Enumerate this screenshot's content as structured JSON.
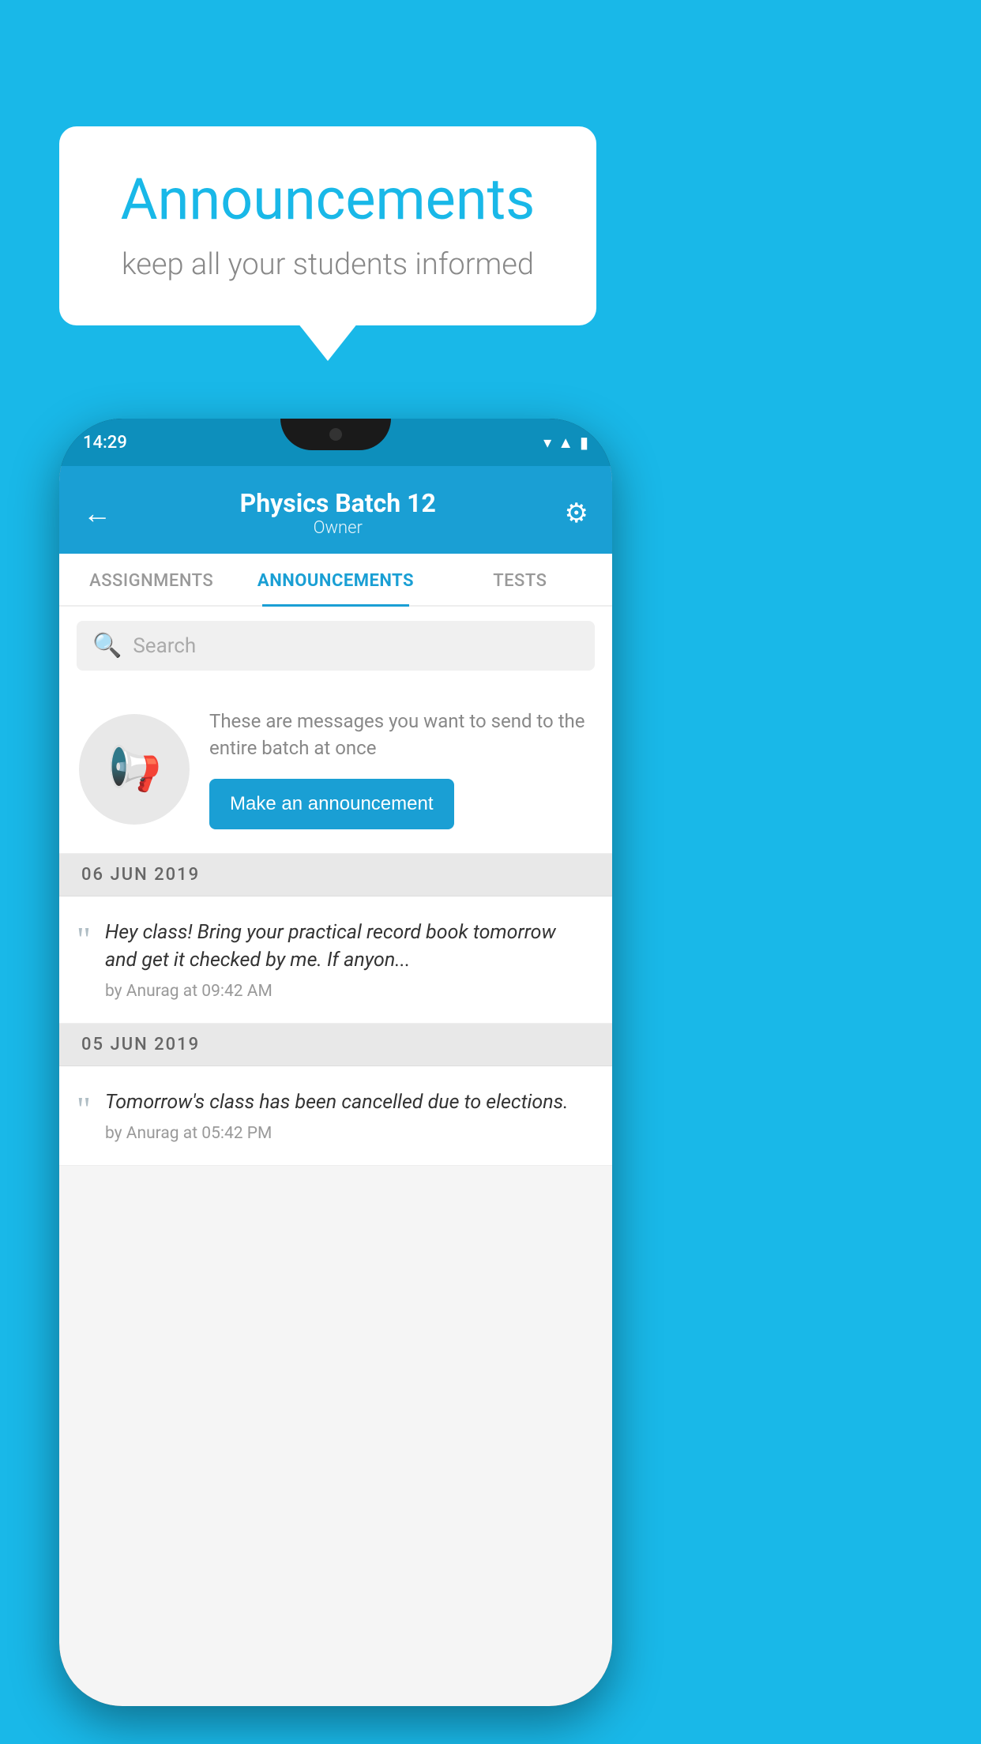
{
  "background_color": "#19b8e8",
  "speech_bubble": {
    "title": "Announcements",
    "subtitle": "keep all your students informed"
  },
  "phone": {
    "status_bar": {
      "time": "14:29",
      "icons": [
        "wifi",
        "signal",
        "battery"
      ]
    },
    "app_bar": {
      "title": "Physics Batch 12",
      "subtitle": "Owner",
      "back_label": "←",
      "settings_label": "⚙"
    },
    "tabs": [
      {
        "label": "ASSIGNMENTS",
        "active": false
      },
      {
        "label": "ANNOUNCEMENTS",
        "active": true
      },
      {
        "label": "TESTS",
        "active": false
      },
      {
        "label": "...",
        "active": false
      }
    ],
    "search": {
      "placeholder": "Search"
    },
    "announcement_prompt": {
      "description": "These are messages you want to send to the entire batch at once",
      "button_label": "Make an announcement"
    },
    "announcements": [
      {
        "date": "06  JUN  2019",
        "text": "Hey class! Bring your practical record book tomorrow and get it checked by me. If anyon...",
        "meta": "by Anurag at 09:42 AM"
      },
      {
        "date": "05  JUN  2019",
        "text": "Tomorrow's class has been cancelled due to elections.",
        "meta": "by Anurag at 05:42 PM"
      }
    ]
  }
}
